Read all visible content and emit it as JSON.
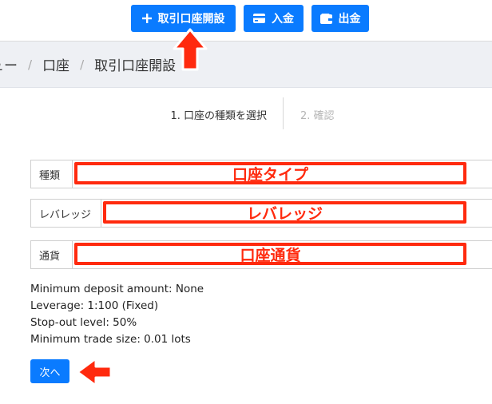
{
  "toolbar": {
    "open_account_label": "取引口座開設",
    "deposit_label": "入金",
    "withdraw_label": "出金"
  },
  "breadcrumb": {
    "items": [
      "ュー",
      "口座",
      "取引口座開設"
    ],
    "separator": "/"
  },
  "steps": {
    "step1": "1. 口座の種類を選択",
    "step2": "2. 確認"
  },
  "form": {
    "type_label": "種類",
    "type_annotation": "口座タイプ",
    "leverage_label": "レバレッジ",
    "leverage_annotation": "レバレッジ",
    "currency_label": "通貨",
    "currency_annotation": "口座通貨"
  },
  "info": {
    "min_deposit": "Minimum deposit amount: None",
    "leverage": "Leverage: 1:100 (Fixed)",
    "stop_out": "Stop-out level: 50%",
    "min_trade": "Minimum trade size: 0.01 lots"
  },
  "actions": {
    "next_label": "次へ"
  },
  "colors": {
    "primary": "#0a7bff",
    "annotation": "#ff2a0e",
    "breadcrumb_bg": "#eef0f4"
  },
  "icons": {
    "open_account": "plus-icon",
    "deposit": "credit-card-icon",
    "withdraw": "wallet-icon"
  }
}
